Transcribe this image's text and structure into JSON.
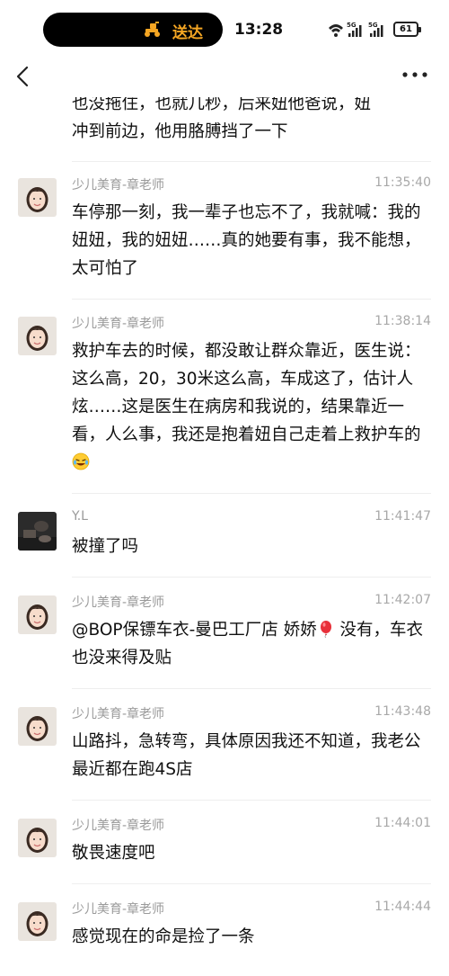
{
  "status_bar": {
    "delivery_label": "送达",
    "time": "13:28",
    "network_1": "5G",
    "network_2": "5G",
    "battery": "61"
  },
  "nav": {
    "back_icon": "chevron-left-icon",
    "more_icon": "more-dots-icon"
  },
  "continued_message": {
    "line1": "也没拖住，也就几秒，后来妞他爸说，妞",
    "line2": "冲到前边，他用胳膊挡了一下"
  },
  "messages": [
    {
      "sender": "少儿美育-章老师",
      "time": "11:35:40",
      "text": "车停那一刻，我一辈子也忘不了，我就喊：我的妞妞，我的妞妞……真的她要有事，我不能想，太可怕了"
    },
    {
      "sender": "少儿美育-章老师",
      "time": "11:38:14",
      "text": "救护车去的时候，都没敢让群众靠近，医生说：这么高，20，30米这么高，车成这了，估计人炫……这是医生在病房和我说的，结果靠近一看，人么事，我还是抱着妞自己走着上救护车的",
      "emoji": "laughing-crying-emoji"
    },
    {
      "sender": "Y.L",
      "time": "11:41:47",
      "text": "被撞了吗"
    },
    {
      "sender": "少儿美育-章老师",
      "time": "11:42:07",
      "text_before": "@BOP保镖车衣-曼巴工厂店 娇娇",
      "text_after": " 没有，车衣也没来得及贴",
      "emoji": "red-balloon-emoji"
    },
    {
      "sender": "少儿美育-章老师",
      "time": "11:43:48",
      "text": "山路抖，急转弯，具体原因我还不知道，我老公最近都在跑4S店"
    },
    {
      "sender": "少儿美育-章老师",
      "time": "11:44:01",
      "text": "敬畏速度吧"
    },
    {
      "sender": "少儿美育-章老师",
      "time": "11:44:44",
      "text": "感觉现在的命是捡了一条"
    }
  ],
  "colors": {
    "accent_orange": "#f5a623",
    "sender_gray": "#9a9a9a",
    "divider": "#eeeeee"
  }
}
